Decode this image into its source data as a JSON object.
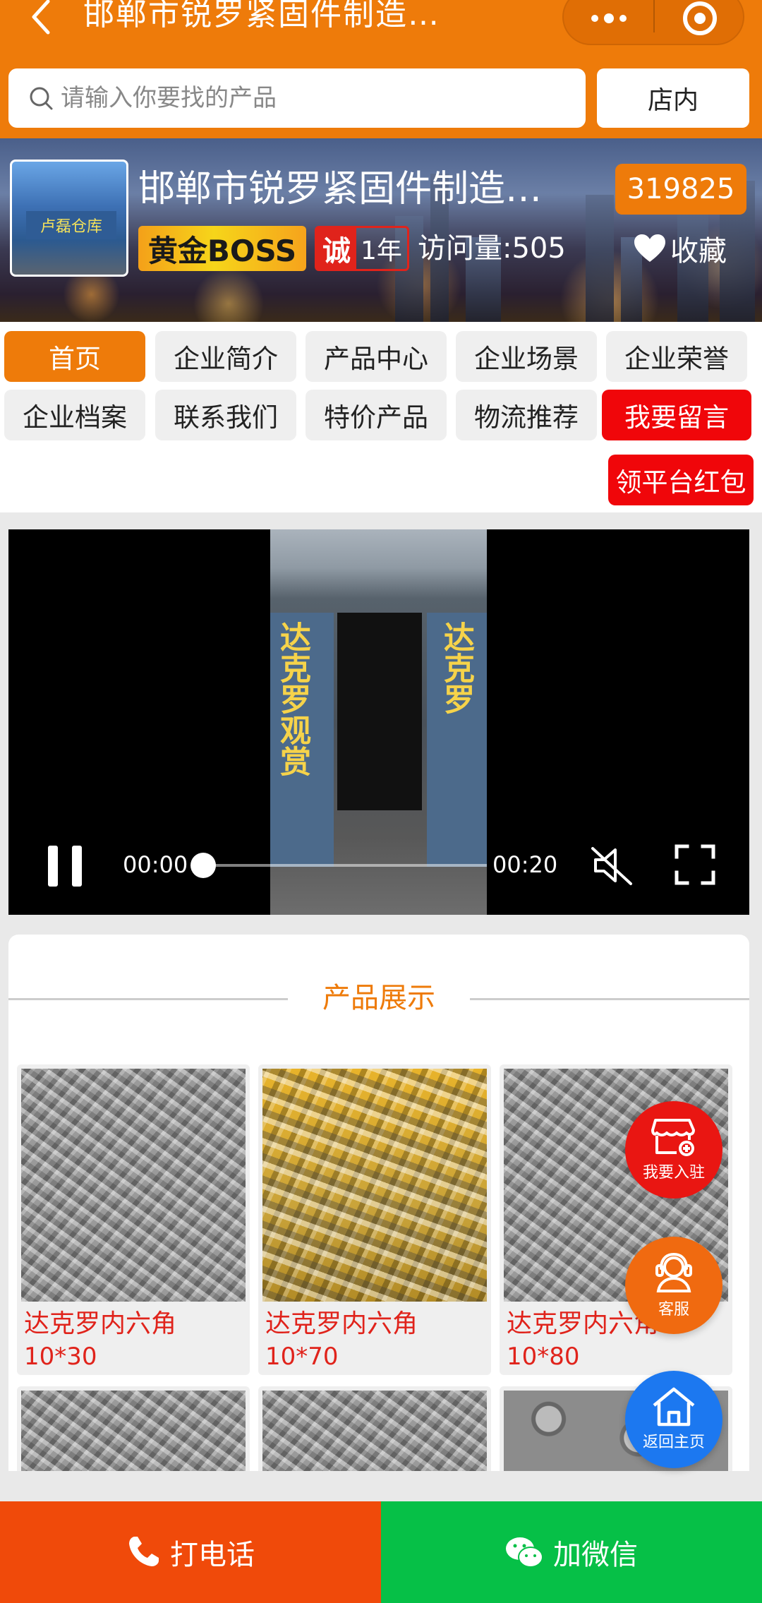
{
  "header": {
    "title": "邯郸市锐罗紧固件制造…",
    "search_placeholder": "请输入你要找的产品",
    "instore_label": "店内",
    "icons": [
      "back-arrow-icon",
      "more-dots-icon",
      "close-target-icon",
      "search-icon"
    ]
  },
  "shop": {
    "name": "邯郸市锐罗紧固件制造…",
    "id_number": "319825",
    "boss_badge": "黄金BOSS",
    "cheng_char": "诚",
    "years": "1年",
    "visits": "访问量:505",
    "favorite_label": "收藏",
    "logo_sign": "卢磊仓库"
  },
  "nav": {
    "items": [
      {
        "label": "首页"
      },
      {
        "label": "企业简介"
      },
      {
        "label": "产品中心"
      },
      {
        "label": "企业场景"
      },
      {
        "label": "企业荣誉"
      },
      {
        "label": "企业档案"
      },
      {
        "label": "联系我们"
      },
      {
        "label": "特价产品"
      },
      {
        "label": "物流推荐"
      },
      {
        "label": "我要留言"
      }
    ],
    "redpack_label": "领平台红包"
  },
  "video": {
    "current_time": "00:00",
    "duration": "00:20",
    "progress": 0,
    "frame_text_left": "达克罗观赏",
    "frame_text_right": "达克罗"
  },
  "products": {
    "section_title": "产品展示",
    "items": [
      {
        "name": "达克罗内六角",
        "spec": "10*30"
      },
      {
        "name": "达克罗内六角",
        "spec": "10*70"
      },
      {
        "name": "达克罗内六角",
        "spec": "10*80"
      }
    ]
  },
  "floating": {
    "join_label": "我要入驻",
    "service_label": "客服",
    "home_label": "返回主页"
  },
  "bottom": {
    "call_label": "打电话",
    "wechat_label": "加微信"
  },
  "colors": {
    "accent_orange": "#ee7b0a",
    "red": "#f0060a",
    "green": "#06c047",
    "blue": "#1c78f0"
  }
}
